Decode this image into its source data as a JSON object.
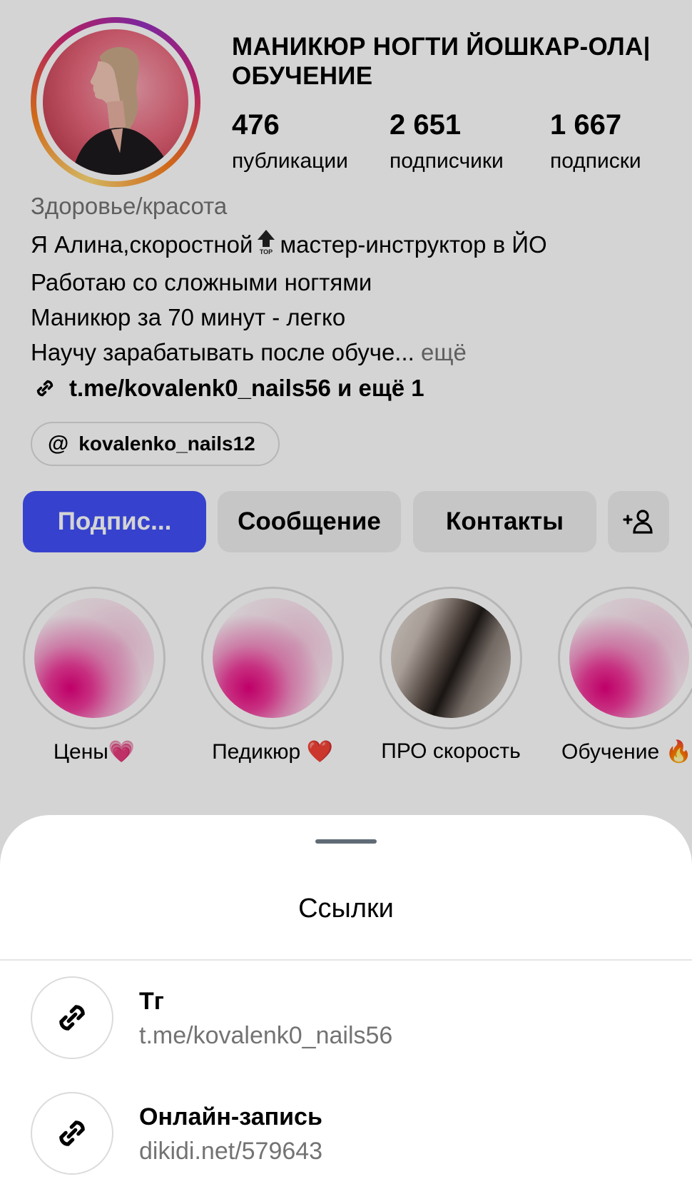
{
  "profile": {
    "name": "МАНИКЮР НОГТИ ЙОШКАР-ОЛА| ОБУЧЕНИЕ",
    "stats": [
      {
        "value": "476",
        "label": "публикации"
      },
      {
        "value": "2 651",
        "label": "подписчики"
      },
      {
        "value": "1 667",
        "label": "подписки"
      }
    ],
    "category": "Здоровье/красота",
    "bio": {
      "line1_pre": "Я Алина,скоростной",
      "line1_post": "мастер-инструктор в ЙО",
      "line2": "Работаю со сложными ногтями",
      "line3": "Маникюр за 70 минут - легко",
      "line4": "Научу зарабатывать после обуче...",
      "more": "ещё",
      "top_icon": "top-arrow-emoji"
    },
    "link_summary": "t.me/kovalenk0_nails56 и ещё 1",
    "threads_handle": "kovalenko_nails12"
  },
  "buttons": {
    "follow": "Подпис...",
    "message": "Сообщение",
    "contacts": "Контакты",
    "add_person_icon": "add-person-icon"
  },
  "highlights": [
    {
      "label": "Цены💗",
      "thumb": "pink"
    },
    {
      "label": "Педикюр ❤️",
      "thumb": "pink"
    },
    {
      "label": "ПРО скорость",
      "thumb": "photo"
    },
    {
      "label": "Обучение 🔥",
      "thumb": "pink"
    }
  ],
  "sheet": {
    "title": "Ссылки",
    "links": [
      {
        "title": "Тг",
        "url": "t.me/kovalenk0_nails56"
      },
      {
        "title": "Онлайн-запись",
        "url": "dikidi.net/579643"
      }
    ]
  },
  "colors": {
    "primary_button": "#4150f7",
    "secondary_button": "#efefef",
    "muted_text": "#737373"
  }
}
